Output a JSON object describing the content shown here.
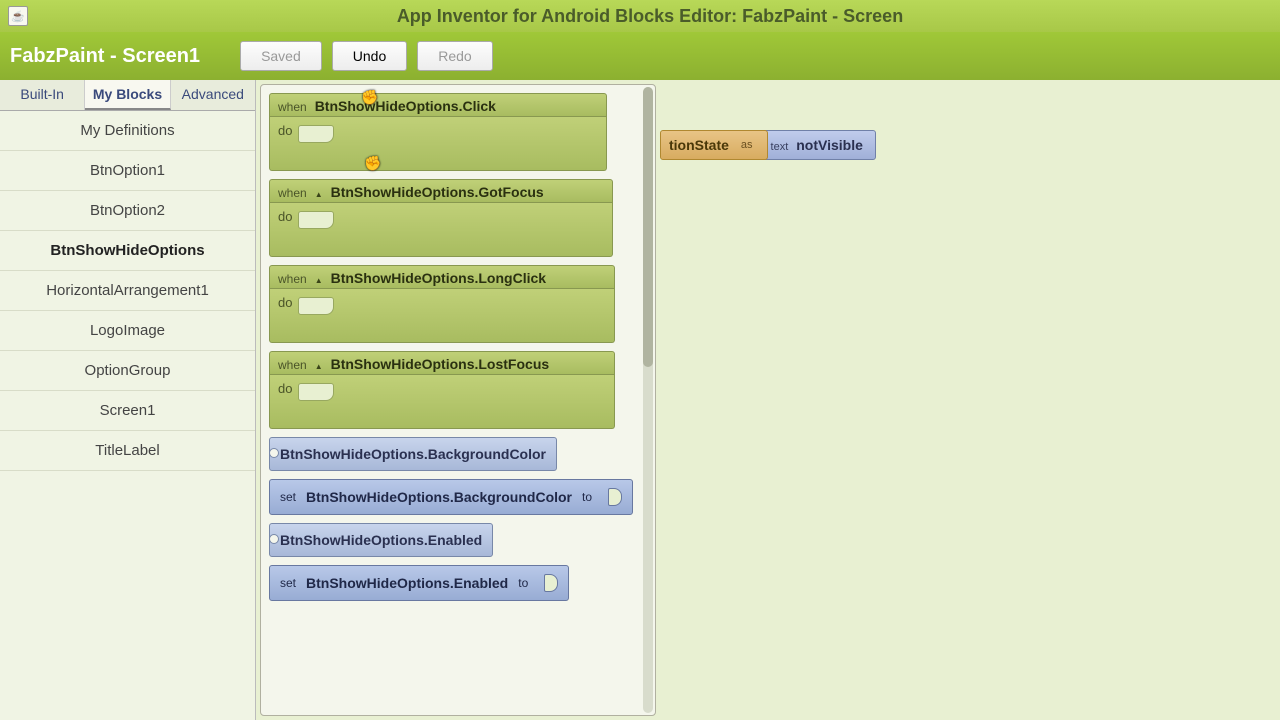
{
  "titlebar": {
    "title": "App Inventor for Android Blocks Editor: FabzPaint - Screen"
  },
  "header": {
    "screen_name": "FabzPaint - Screen1",
    "saved": "Saved",
    "undo": "Undo",
    "redo": "Redo"
  },
  "tabs": {
    "builtin": "Built-In",
    "myblocks": "My Blocks",
    "advanced": "Advanced"
  },
  "sidebar": {
    "items": [
      "My Definitions",
      "BtnOption1",
      "BtnOption2",
      "BtnShowHideOptions",
      "HorizontalArrangement1",
      "LogoImage",
      "OptionGroup",
      "Screen1",
      "TitleLabel"
    ],
    "selected_index": 3
  },
  "flyout": {
    "keywords": {
      "when": "when",
      "do": "do",
      "set": "set",
      "to": "to"
    },
    "events": [
      "BtnShowHideOptions.Click",
      "BtnShowHideOptions.GotFocus",
      "BtnShowHideOptions.LongClick",
      "BtnShowHideOptions.LostFocus"
    ],
    "getters": [
      "BtnShowHideOptions.BackgroundColor"
    ],
    "setters": [
      "BtnShowHideOptions.BackgroundColor"
    ],
    "getters2": [
      "BtnShowHideOptions.Enabled"
    ],
    "setters2": [
      "BtnShowHideOptions.Enabled"
    ]
  },
  "workspace": {
    "def_partial": "tionState",
    "as": "as",
    "text_kw": "text",
    "text_val": "notVisible"
  }
}
